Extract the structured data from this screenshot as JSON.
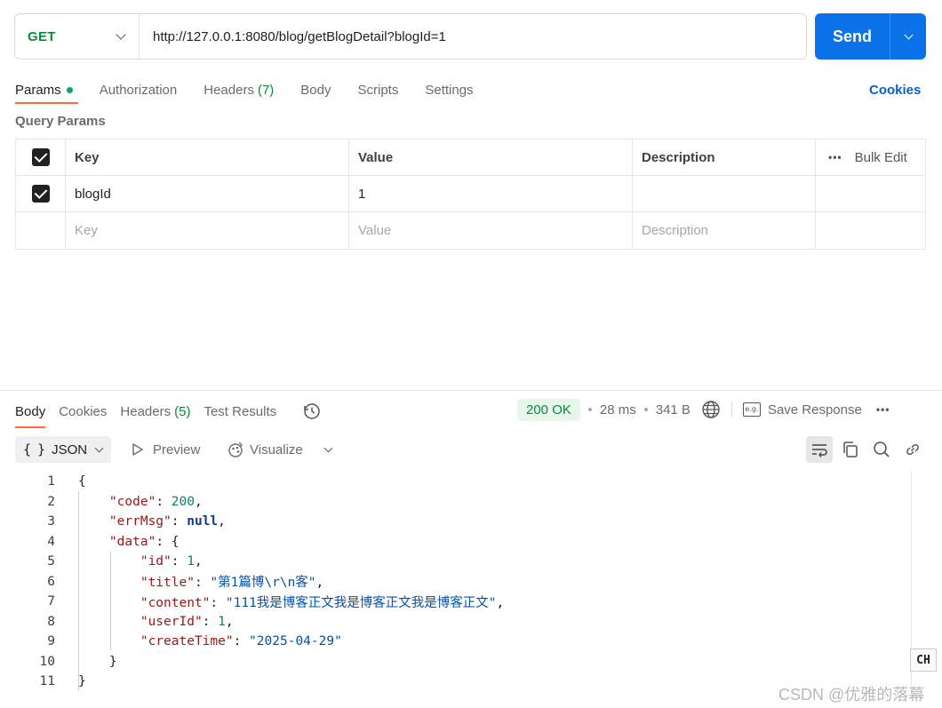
{
  "request": {
    "method": "GET",
    "url": "http://127.0.0.1:8080/blog/getBlogDetail?blogId=1",
    "send_label": "Send"
  },
  "request_tabs": [
    {
      "label": "Params"
    },
    {
      "label": "Authorization"
    },
    {
      "label": "Headers",
      "count": "(7)"
    },
    {
      "label": "Body"
    },
    {
      "label": "Scripts"
    },
    {
      "label": "Settings"
    }
  ],
  "cookies_link": "Cookies",
  "query_params": {
    "title": "Query Params",
    "headers": {
      "key": "Key",
      "value": "Value",
      "description": "Description",
      "bulk_edit": "Bulk Edit"
    },
    "rows": [
      {
        "key": "blogId",
        "value": "1",
        "description": ""
      }
    ],
    "placeholders": {
      "key": "Key",
      "value": "Value",
      "description": "Description"
    }
  },
  "response_tabs": [
    {
      "label": "Body"
    },
    {
      "label": "Cookies"
    },
    {
      "label": "Headers",
      "count": "(5)"
    },
    {
      "label": "Test Results"
    }
  ],
  "response_meta": {
    "status": "200 OK",
    "time": "28 ms",
    "size": "341 B",
    "save_response": "Save Response",
    "save_icon_text": "e.g."
  },
  "response_toolbar": {
    "format": "JSON",
    "braces": "{ }",
    "preview": "Preview",
    "visualize": "Visualize"
  },
  "code_lines": [
    "1",
    "2",
    "3",
    "4",
    "5",
    "6",
    "7",
    "8",
    "9",
    "10",
    "11"
  ],
  "response_body": {
    "l1": "{",
    "code_key": "\"code\"",
    "code_val": "200",
    "errmsg_key": "\"errMsg\"",
    "errmsg_val": "null",
    "data_key": "\"data\"",
    "open_brace": "{",
    "id_key": "\"id\"",
    "id_val": "1",
    "title_key": "\"title\"",
    "title_val": "\"第1篇博\\r\\n客\"",
    "content_key": "\"content\"",
    "content_val": "\"111我是博客正文我是博客正文我是博客正文\"",
    "userid_key": "\"userId\"",
    "userid_val": "1",
    "createtime_key": "\"createTime\"",
    "createtime_val": "\"2025-04-29\"",
    "inner_close": "}",
    "outer_close": "}"
  },
  "ime_indicator": "CH",
  "watermark": "CSDN @优雅的落幕",
  "colors": {
    "send": "#0c72e8",
    "method": "#0b8a3a",
    "accent_tab": "#ff6c37",
    "status_ok": "#0b8a3a"
  }
}
